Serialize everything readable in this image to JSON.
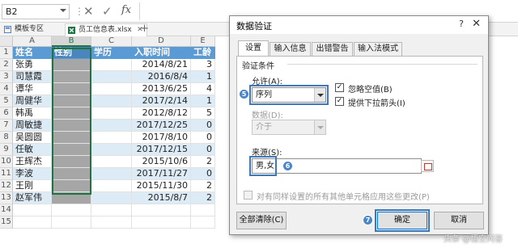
{
  "formula_bar": {
    "name_box": "B2",
    "cancel": "✕",
    "confirm": "✓",
    "fx": "fx",
    "separator": "⋮"
  },
  "tabs": [
    {
      "label": "模板专区",
      "icon": "template-icon"
    },
    {
      "label": "员工信息表.xlsx",
      "icon": "excel-file-icon",
      "close": "✕"
    }
  ],
  "tab_add": "+",
  "columns": [
    "A",
    "B",
    "C",
    "D",
    "E"
  ],
  "rows": [
    "1",
    "2",
    "3",
    "4",
    "5",
    "6",
    "7",
    "8",
    "9",
    "10",
    "11",
    "12",
    "13",
    "14",
    "15"
  ],
  "header": {
    "name": "姓名",
    "gender": "性别",
    "education": "学历",
    "hire_date": "入职时间",
    "seniority": "工龄"
  },
  "employees": [
    {
      "name": "张勇",
      "date": "2014/8/21",
      "years": "3"
    },
    {
      "name": "司慧霞",
      "date": "2016/8/4",
      "years": "1"
    },
    {
      "name": "谭华",
      "date": "2013/6/25",
      "years": "4"
    },
    {
      "name": "周健华",
      "date": "2017/2/14",
      "years": "1"
    },
    {
      "name": "韩禹",
      "date": "2012/8/12",
      "years": "5"
    },
    {
      "name": "周敏捷",
      "date": "2017/12/25",
      "years": "0"
    },
    {
      "name": "吴圆圆",
      "date": "2017/8/10",
      "years": "0"
    },
    {
      "name": "任敏",
      "date": "2017/12/15",
      "years": "0"
    },
    {
      "name": "王辉杰",
      "date": "2015/10/6",
      "years": "2"
    },
    {
      "name": "李波",
      "date": "2017/11/27",
      "years": "0"
    },
    {
      "name": "王刚",
      "date": "2015/11/30",
      "years": "2"
    },
    {
      "name": "赵军伟",
      "date": "2015/8/7",
      "years": "2"
    }
  ],
  "dialog": {
    "title": "数据验证",
    "help": "?",
    "close": "✕",
    "tabs": [
      "设置",
      "输入信息",
      "出错警告",
      "输入法模式"
    ],
    "group_label": "验证条件",
    "allow_label": "允许(A):",
    "allow_value": "序列",
    "ignore_blank": "忽略空值(B)",
    "dropdown_arrow": "提供下拉箭头(I)",
    "data_label": "数据(D):",
    "data_value": "介于",
    "source_label": "来源(S):",
    "source_value": "男,女",
    "apply_all": "对有同样设置的所有其他单元格应用这些更改(P)",
    "clear_all": "全部清除(C)",
    "ok": "确定",
    "cancel": "取消",
    "steps": [
      "5",
      "6",
      "7"
    ],
    "check_mark": "✓"
  },
  "watermark": "头条 @悟空问答"
}
